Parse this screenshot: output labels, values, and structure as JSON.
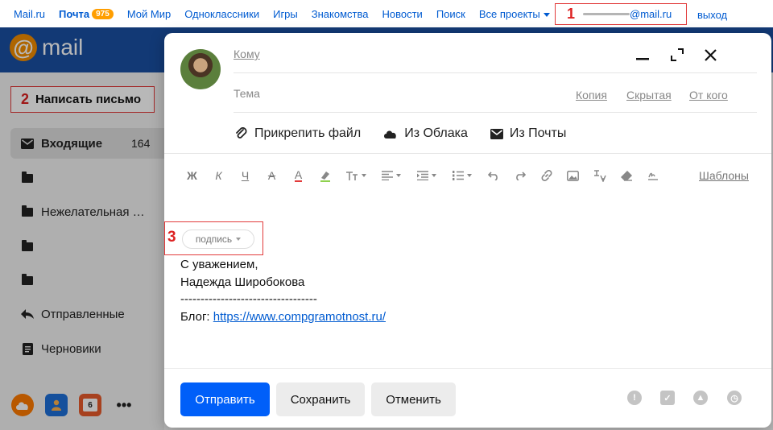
{
  "topbar": {
    "links": [
      "Mail.ru",
      "Почта",
      "Мой Мир",
      "Одноклассники",
      "Игры",
      "Знакомства",
      "Новости",
      "Поиск",
      "Все проекты"
    ],
    "mail_badge": "975",
    "account_marker": "1",
    "account_suffix": "@mail.ru",
    "logout": "выход"
  },
  "logo": {
    "text": "mail",
    "at": "@"
  },
  "sidebar": {
    "compose_marker": "2",
    "compose_label": "Написать письмо",
    "items": [
      {
        "label": "Входящие",
        "count": "164",
        "icon": "envelope-icon"
      },
      {
        "label": "",
        "icon": "folder-icon"
      },
      {
        "label": "Нежелательная …",
        "icon": "folder-icon"
      },
      {
        "label": "",
        "icon": "folder-icon"
      },
      {
        "label": "",
        "icon": "folder-icon"
      },
      {
        "label": "Отправленные",
        "icon": "sent-icon"
      },
      {
        "label": "Черновики",
        "icon": "draft-icon"
      }
    ],
    "calendar_day": "6"
  },
  "compose": {
    "to_label": "Кому",
    "subject_label": "Тема",
    "copy_link": "Копия",
    "hidden_link": "Скрытая",
    "from_link": "От кого",
    "attach": [
      "Прикрепить файл",
      "Из Облака",
      "Из Почты"
    ],
    "toolbar": [
      "Ж",
      "К",
      "Ч",
      "A",
      "A"
    ],
    "templates": "Шаблоны",
    "signature_marker": "3",
    "signature_select": "подпись",
    "body": {
      "line1": "С уважением,",
      "line2": "Надежда Широбокова",
      "separator": "----------------------------------",
      "blog_label": "Блог: ",
      "blog_link": "https://www.compgramotnost.ru/"
    },
    "buttons": {
      "send": "Отправить",
      "save": "Сохранить",
      "cancel": "Отменить"
    }
  },
  "colors": {
    "header": "#1a4fa3",
    "primary": "#005ff9",
    "link": "#005bd1",
    "marker": "#e23b3b",
    "badge": "#ff9e00"
  }
}
